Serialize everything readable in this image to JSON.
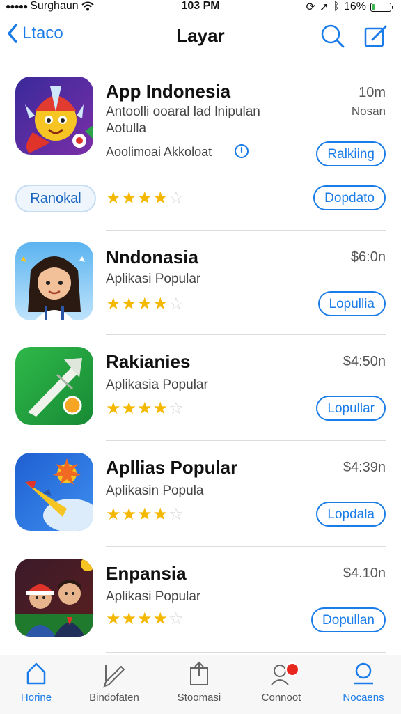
{
  "status_bar": {
    "carrier": "Surghaun",
    "time": "103 PM",
    "battery": "16%",
    "battery_level": 0.16
  },
  "nav": {
    "back_label": "Ltaco",
    "title": "Layar"
  },
  "featured": {
    "name": "App Indonesia",
    "desc_line1": "Antoolli ooaral lad lnipulan",
    "desc_line2": "Aotulla",
    "meta": "Aoolimoai Akkoloat",
    "price": "10m",
    "price_sub": "Nosan",
    "ranking_button": "Ralkiing",
    "pill_button": "Ranokal",
    "action_button": "Dopdato",
    "rating": 4
  },
  "apps": [
    {
      "name": "Nndonasia",
      "subtitle": "Aplikasi Popular",
      "price": "$6:0n",
      "button": "Lopullia",
      "rating": 4
    },
    {
      "name": "Rakianies",
      "subtitle": "Aplikasia Popular",
      "price": "$4:50n",
      "button": "Lopullar",
      "rating": 4
    },
    {
      "name": "Apllias Popular",
      "subtitle": "Aplikasin Popula",
      "price": "$4:39n",
      "button": "Lopdala",
      "rating": 4
    },
    {
      "name": "Enpansia",
      "subtitle": "Aplikasi Popular",
      "price": "$4.10n",
      "button": "Dopullan",
      "rating": 4
    }
  ],
  "tabs": [
    {
      "label": "Horine",
      "icon": "home-icon",
      "active": true
    },
    {
      "label": "Bindofaten",
      "icon": "pen-icon",
      "active": false
    },
    {
      "label": "Stoomasi",
      "icon": "share-icon",
      "active": false
    },
    {
      "label": "Connoot",
      "icon": "contacts-icon",
      "active": false,
      "badge": true
    },
    {
      "label": "Nocaens",
      "icon": "profile-icon",
      "active": true
    }
  ],
  "colors": {
    "accent": "#1a7ce8",
    "star": "#f5b800",
    "badge": "#e8281e"
  }
}
